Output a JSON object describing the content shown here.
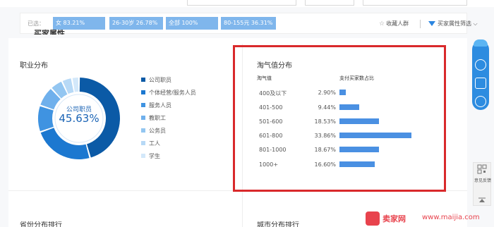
{
  "filter": {
    "label": "已选：",
    "tags": [
      "女 83.21%",
      "26-30岁 26.78%",
      "全部 100%",
      "80-155元 36.31%"
    ],
    "favorite": "收藏人群",
    "attribute_filter": "买家属性筛选"
  },
  "section_cut_title": "买家属性",
  "occupation": {
    "title": "职业分布",
    "center_label": "公司职员",
    "center_value": "45.63%",
    "legend": [
      {
        "label": "公司职员",
        "color": "#0b5aa6"
      },
      {
        "label": "个体经营/服务人员",
        "color": "#1c78d0"
      },
      {
        "label": "服务人员",
        "color": "#3f93e1"
      },
      {
        "label": "教职工",
        "color": "#6fb0ec"
      },
      {
        "label": "公务员",
        "color": "#93c6f1"
      },
      {
        "label": "工人",
        "color": "#b7d9f6"
      },
      {
        "label": "学生",
        "color": "#d3e8fa"
      }
    ],
    "chart_data": {
      "type": "pie",
      "categories": [
        "公司职员",
        "个体经营/服务人员",
        "服务人员",
        "教职工",
        "公务员",
        "工人",
        "学生"
      ],
      "values": [
        45.63,
        24.0,
        10.5,
        8.0,
        5.0,
        4.0,
        2.87
      ]
    }
  },
  "taoqi": {
    "title": "淘气值分布",
    "col_range": "淘气值",
    "col_share": "支付买家数占比",
    "chart_data": {
      "type": "bar",
      "categories": [
        "400及以下",
        "401-500",
        "501-600",
        "601-800",
        "801-1000",
        "1000+"
      ],
      "values": [
        2.9,
        9.44,
        18.53,
        33.86,
        18.67,
        16.6
      ],
      "labels": [
        "2.90%",
        "9.44%",
        "18.53%",
        "33.86%",
        "18.67%",
        "16.60%"
      ],
      "xlim": [
        0,
        33.86
      ]
    }
  },
  "bottom": {
    "left_title": "省份分布排行",
    "right_title": "城市分布排行"
  },
  "feedback": {
    "label": "意见反馈"
  },
  "watermark": {
    "brand": "卖家网",
    "site": "www.maijia.com"
  }
}
